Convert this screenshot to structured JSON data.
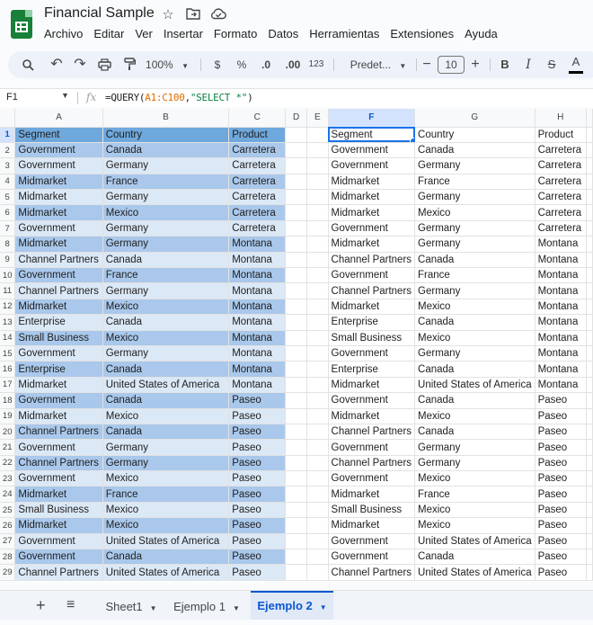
{
  "doc_title": "Financial Sample",
  "menu": [
    "Archivo",
    "Editar",
    "Ver",
    "Insertar",
    "Formato",
    "Datos",
    "Herramientas",
    "Extensiones",
    "Ayuda"
  ],
  "toolbar": {
    "zoom": "100%",
    "currency": "$",
    "percent": "%",
    "dec_dec": ".0",
    "dec_inc": ".00",
    "num_format": "123",
    "font": "Predet...",
    "font_size": "10"
  },
  "name_box": "F1",
  "formula": {
    "prefix": "=QUERY(",
    "range": "A1:C100",
    "comma": ",",
    "query": "\"SELECT *\"",
    "suffix": ")"
  },
  "columns": [
    "A",
    "B",
    "C",
    "D",
    "E",
    "F",
    "G",
    "H"
  ],
  "header": [
    "Segment",
    "Country",
    "Product"
  ],
  "rows": [
    [
      "Government",
      "Canada",
      "Carretera"
    ],
    [
      "Government",
      "Germany",
      "Carretera"
    ],
    [
      "Midmarket",
      "France",
      "Carretera"
    ],
    [
      "Midmarket",
      "Germany",
      "Carretera"
    ],
    [
      "Midmarket",
      "Mexico",
      "Carretera"
    ],
    [
      "Government",
      "Germany",
      "Carretera"
    ],
    [
      "Midmarket",
      "Germany",
      "Montana"
    ],
    [
      "Channel Partners",
      "Canada",
      "Montana"
    ],
    [
      "Government",
      "France",
      "Montana"
    ],
    [
      "Channel Partners",
      "Germany",
      "Montana"
    ],
    [
      "Midmarket",
      "Mexico",
      "Montana"
    ],
    [
      "Enterprise",
      "Canada",
      "Montana"
    ],
    [
      "Small Business",
      "Mexico",
      "Montana"
    ],
    [
      "Government",
      "Germany",
      "Montana"
    ],
    [
      "Enterprise",
      "Canada",
      "Montana"
    ],
    [
      "Midmarket",
      "United States of America",
      "Montana"
    ],
    [
      "Government",
      "Canada",
      "Paseo"
    ],
    [
      "Midmarket",
      "Mexico",
      "Paseo"
    ],
    [
      "Channel Partners",
      "Canada",
      "Paseo"
    ],
    [
      "Government",
      "Germany",
      "Paseo"
    ],
    [
      "Channel Partners",
      "Germany",
      "Paseo"
    ],
    [
      "Government",
      "Mexico",
      "Paseo"
    ],
    [
      "Midmarket",
      "France",
      "Paseo"
    ],
    [
      "Small Business",
      "Mexico",
      "Paseo"
    ],
    [
      "Midmarket",
      "Mexico",
      "Paseo"
    ],
    [
      "Government",
      "United States of America",
      "Paseo"
    ],
    [
      "Government",
      "Canada",
      "Paseo"
    ],
    [
      "Channel Partners",
      "United States of America",
      "Paseo"
    ]
  ],
  "sheets": [
    "Sheet1",
    "Ejemplo 1",
    "Ejemplo 2"
  ],
  "active_sheet": "Ejemplo 2",
  "colors": {
    "header_blue": "#6fa8dc",
    "band_dark": "#a9c8eb",
    "band_light": "#dbe8f6",
    "accent": "#0b57d0"
  }
}
